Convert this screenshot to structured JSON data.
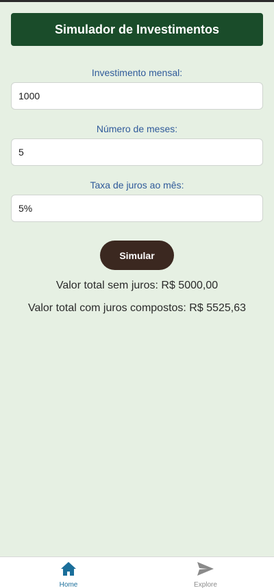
{
  "header": {
    "title": "Simulador de Investimentos"
  },
  "form": {
    "monthly_label": "Investimento mensal:",
    "monthly_value": "1000",
    "months_label": "Número de meses:",
    "months_value": "5",
    "rate_label": "Taxa de juros ao mês:",
    "rate_value": "5%",
    "submit_label": "Simular"
  },
  "results": {
    "without_interest": "Valor total sem juros: R$ 5000,00",
    "compound_interest": "Valor total com juros compostos: R$ 5525,63"
  },
  "tabbar": {
    "items": [
      {
        "label": "Home",
        "icon": "home-icon",
        "active": true,
        "color": "#1a6e9a"
      },
      {
        "label": "Explore",
        "icon": "send-icon",
        "active": false,
        "color": "#8a8a8a"
      }
    ]
  },
  "colors": {
    "background": "#e6f0e3",
    "header_bg": "#1a4c2a",
    "label": "#2f5a9a",
    "button_bg": "#3b2820"
  }
}
